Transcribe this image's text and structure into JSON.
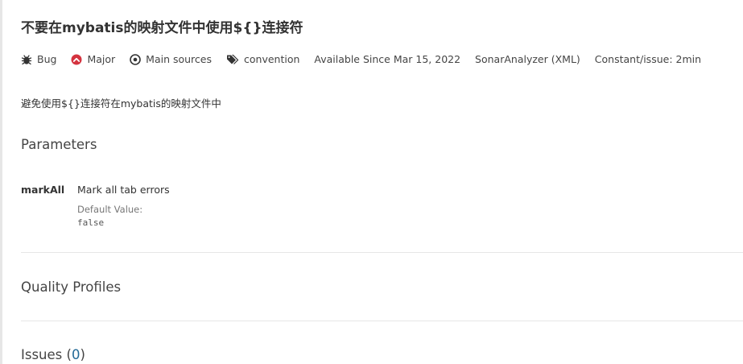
{
  "rule": {
    "title": "不要在mybatis的映射文件中使用${}连接符",
    "description": "避免使用${}连接符在mybatis的映射文件中"
  },
  "meta": {
    "type": "Bug",
    "severity": "Major",
    "scope": "Main sources",
    "tag": "convention",
    "available_since": "Available Since Mar 15, 2022",
    "analyzer": "SonarAnalyzer (XML)",
    "remediation": "Constant/issue: 2min"
  },
  "parameters": {
    "section_title": "Parameters",
    "items": [
      {
        "key": "markAll",
        "description": "Mark all tab errors",
        "default_label": "Default Value:",
        "default_value": "false"
      }
    ]
  },
  "quality_profiles": {
    "section_title": "Quality Profiles"
  },
  "issues": {
    "label": "Issues (",
    "count": "0",
    "suffix": ")"
  },
  "colors": {
    "major": "#d4333f",
    "link": "#236a97",
    "divider": "#e6e6e6"
  },
  "icons": {
    "type": "bug-icon",
    "severity": "major-severity-icon",
    "scope": "target-icon",
    "tag": "tags-icon"
  }
}
